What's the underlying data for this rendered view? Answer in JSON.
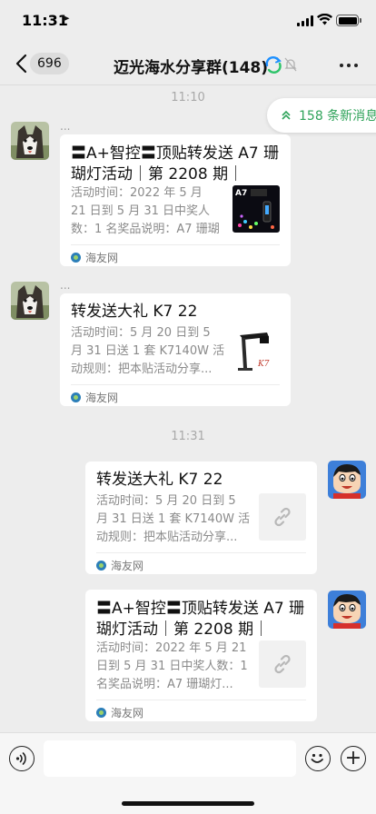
{
  "status_bar": {
    "time": "11:31"
  },
  "nav": {
    "back_count": "696",
    "title": "迈光海水分享群(148)"
  },
  "new_messages": {
    "label": "158 条新消息"
  },
  "timestamps": [
    "11:10",
    "11:31"
  ],
  "messages": [
    {
      "side": "left",
      "sender": "...",
      "title": "〓A+智控〓顶贴转发送 A7 珊瑚灯活动｜第 2208 期｜",
      "description": "活动时间：2022 年 5 月 21 日到 5 月 31 日中奖人数：1 名奖品说明：A7 珊瑚灯...",
      "source": "海友网",
      "thumb": "A7"
    },
    {
      "side": "left",
      "sender": "...",
      "title": "转发送大礼 K7 22",
      "description": "活动时间：5 月 20 日到 5 月 31 日送 1 套 K7140W 活动规则：把本贴活动分享...",
      "source": "海友网",
      "thumb": "K7"
    },
    {
      "side": "right",
      "title": "转发送大礼 K7 22",
      "description": "活动时间：5 月 20 日到 5 月 31 日送 1 套 K7140W 活动规则：把本贴活动分享...",
      "source": "海友网",
      "thumb": "link"
    },
    {
      "side": "right",
      "title": "〓A+智控〓顶贴转发送 A7 珊瑚灯活动｜第 2208 期｜",
      "description": "活动时间：2022 年 5 月 21 日到 5 月 31 日中奖人数：1 名奖品说明：A7 珊瑚灯...",
      "source": "海友网",
      "thumb": "link"
    }
  ],
  "input": {
    "placeholder": ""
  },
  "colors": {
    "accent_green": "#2fa35a",
    "background": "#ededed"
  },
  "icons": {
    "back": "chevron-left-icon",
    "loop": "loop-icon",
    "mute": "bell-muted-icon",
    "more": "more-dots-icon",
    "voice": "voice-icon",
    "emoji": "emoji-icon",
    "plus": "plus-icon",
    "link": "link-icon"
  }
}
